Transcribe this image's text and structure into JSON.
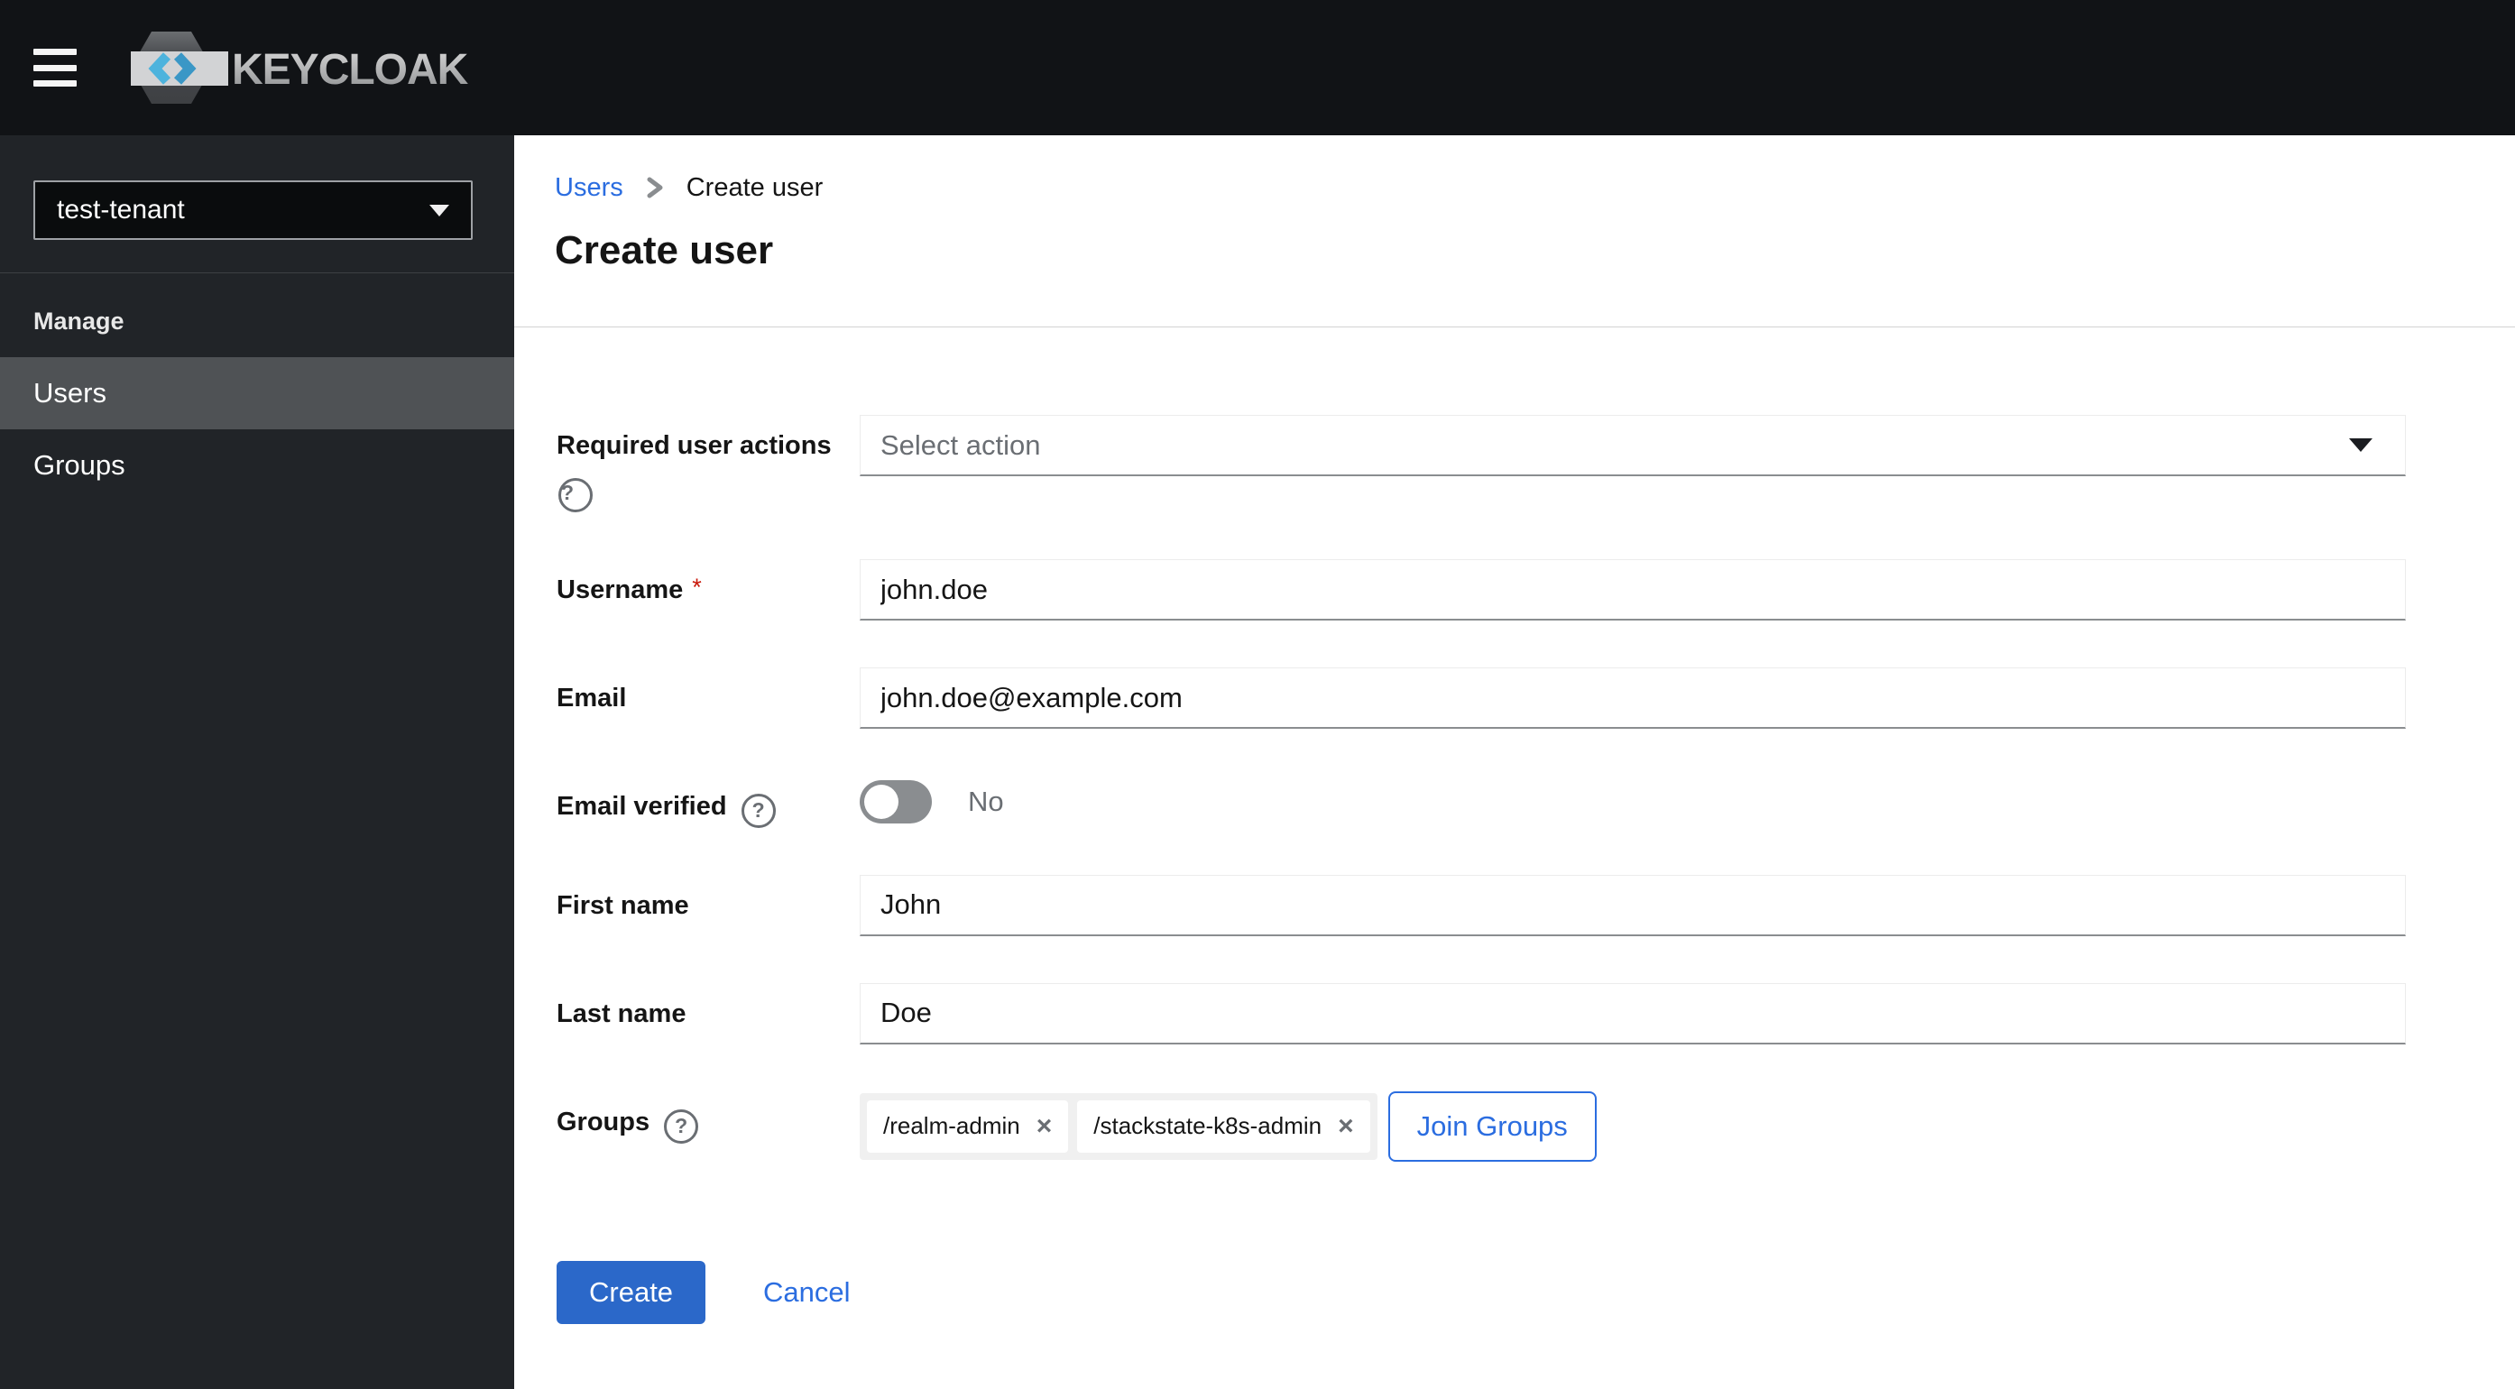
{
  "masthead": {
    "brand": "KEYCLOAK"
  },
  "sidebar": {
    "realm_selector": {
      "value": "test-tenant"
    },
    "section_label": "Manage",
    "items": [
      {
        "label": "Users",
        "selected": true
      },
      {
        "label": "Groups",
        "selected": false
      }
    ]
  },
  "breadcrumb": {
    "items": [
      "Users",
      "Create user"
    ]
  },
  "page": {
    "title": "Create user"
  },
  "form": {
    "required_user_actions": {
      "label": "Required user actions",
      "placeholder": "Select action"
    },
    "username": {
      "label": "Username",
      "value": "john.doe",
      "required_marker": "*"
    },
    "email": {
      "label": "Email",
      "value": "john.doe@example.com"
    },
    "email_verified": {
      "label": "Email verified",
      "state_label": "No",
      "enabled": false
    },
    "first_name": {
      "label": "First name",
      "value": "John"
    },
    "last_name": {
      "label": "Last name",
      "value": "Doe"
    },
    "groups": {
      "label": "Groups",
      "chips": [
        "/realm-admin",
        "/stackstate-k8s-admin"
      ],
      "join_button_label": "Join Groups"
    },
    "actions": {
      "create_label": "Create",
      "cancel_label": "Cancel"
    }
  },
  "icons": {
    "help": "?",
    "close": "×"
  },
  "colors": {
    "accent": "#2b6de0",
    "primary_button": "#2b68c9",
    "danger": "#c9190b"
  }
}
